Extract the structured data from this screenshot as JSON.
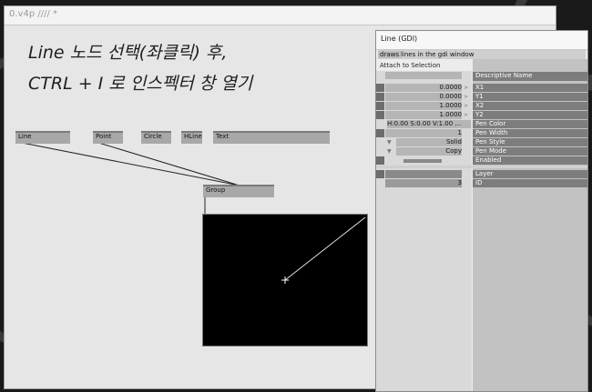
{
  "main_window": {
    "title": "0.v4p //// *"
  },
  "caption": {
    "line1": "Line 노드 선택(좌클릭) 후,",
    "line2": "CTRL + I 로 인스펙터 창 열기"
  },
  "nodes": [
    {
      "label": "Line"
    },
    {
      "label": "Point"
    },
    {
      "label": "Circle"
    },
    {
      "label": "HLine"
    },
    {
      "label": "Text"
    },
    {
      "label": "Group"
    }
  ],
  "inspector": {
    "title": "Line (GDI)",
    "help_prefix": "draws",
    "help_text": "lines in the gdi window",
    "attach_label": "Attach to Selection",
    "header_name": "Descriptive Name",
    "pins": [
      {
        "name": "X1",
        "value": "0.0000"
      },
      {
        "name": "Y1",
        "value": "0.0000"
      },
      {
        "name": "X2",
        "value": "1.0000"
      },
      {
        "name": "Y2",
        "value": "1.0000"
      },
      {
        "name": "Pen Color",
        "value": "H:0.00  S:0.00  V:1.00 ..."
      },
      {
        "name": "Pen Width",
        "value": "1"
      },
      {
        "name": "Pen Style",
        "value": "Solid"
      },
      {
        "name": "Pen Mode",
        "value": "Copy"
      },
      {
        "name": "Enabled",
        "value": ""
      }
    ],
    "out_pins": [
      {
        "name": "Layer",
        "value": ""
      },
      {
        "name": "ID",
        "value": "3"
      }
    ]
  }
}
